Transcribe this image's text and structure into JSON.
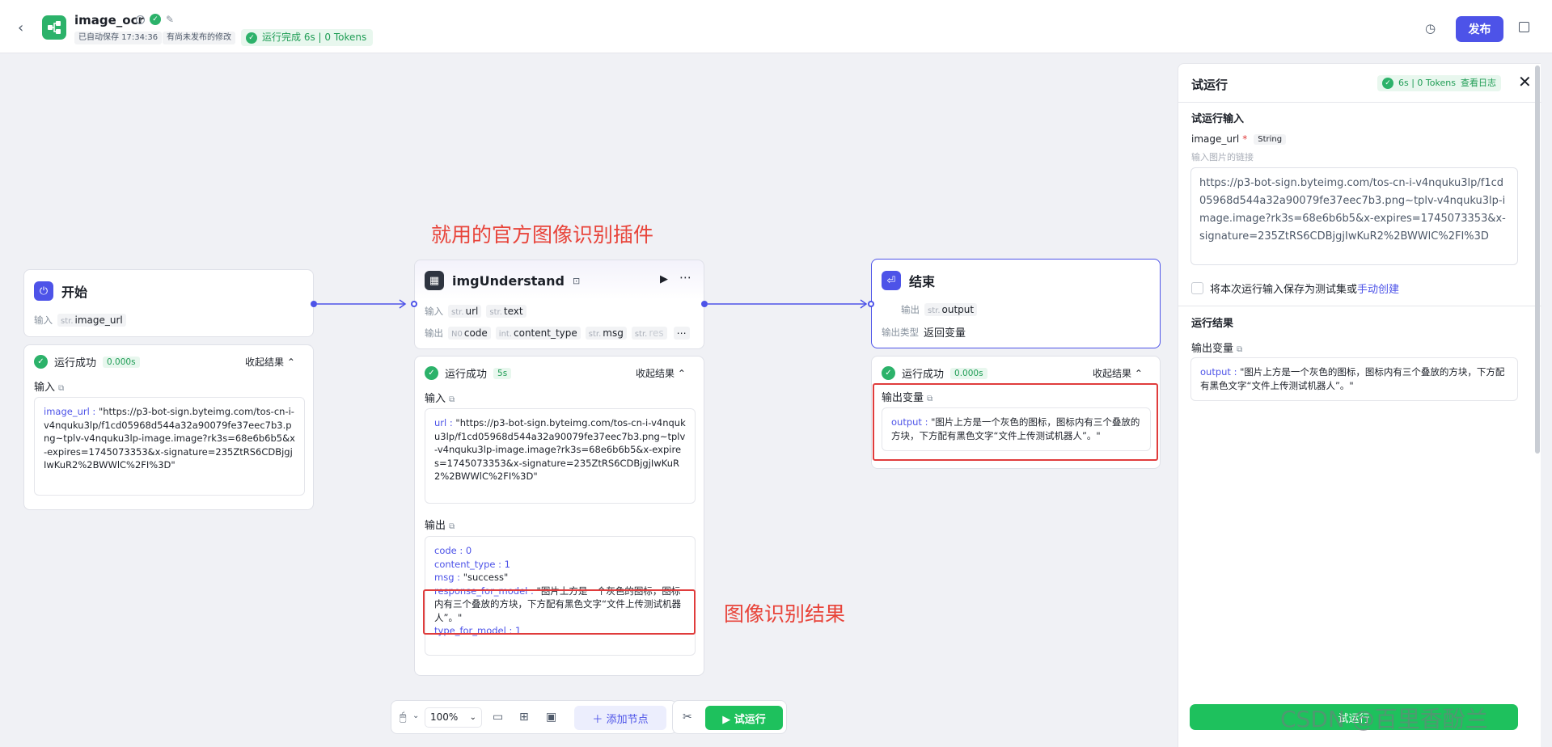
{
  "header": {
    "title": "image_ocr",
    "autosave": "已自动保存 17:34:36",
    "unpublished": "有尚未发布的修改",
    "run_status": "运行完成 6s | 0 Tokens",
    "publish_label": "发布"
  },
  "annotations": {
    "plugin_note": "就用的官方图像识别插件",
    "result_note": "图像识别结果"
  },
  "nodes": {
    "start": {
      "title": "开始",
      "input_label": "输入",
      "param_type": "str.",
      "param_name": "image_url",
      "result": {
        "status": "运行成功",
        "time": "0.000s",
        "collapse": "收起结果",
        "input_section": "输入",
        "key": "image_url",
        "value": "\"https://p3-bot-sign.byteimg.com/tos-cn-i-v4nquku3lp/f1cd05968d544a32a90079fe37eec7b3.png~tplv-v4nquku3lp-image.image?rk3s=68e6b6b5&x-expires=1745073353&x-signature=235ZtRS6CDBjgjIwKuR2%2BWWlC%2FI%3D\""
      }
    },
    "img": {
      "title": "imgUnderstand",
      "input_label": "输入",
      "output_label": "输出",
      "inputs": [
        {
          "type": "str.",
          "name": "url"
        },
        {
          "type": "str.",
          "name": "text"
        }
      ],
      "outputs": [
        {
          "type": "N0",
          "name": "code"
        },
        {
          "type": "int.",
          "name": "content_type"
        },
        {
          "type": "str.",
          "name": "msg"
        },
        {
          "type": "str.",
          "name": "res"
        }
      ],
      "result": {
        "status": "运行成功",
        "time": "5s",
        "collapse": "收起结果",
        "input_section": "输入",
        "input_key": "url",
        "input_value": "\"https://p3-bot-sign.byteimg.com/tos-cn-i-v4nquku3lp/f1cd05968d544a32a90079fe37eec7b3.png~tplv-v4nquku3lp-image.image?rk3s=68e6b6b5&x-expires=1745073353&x-signature=235ZtRS6CDBjgjIwKuR2%2BWWlC%2FI%3D\"",
        "output_section": "输出",
        "lines": [
          {
            "k": "code",
            "v": "0"
          },
          {
            "k": "content_type",
            "v": "1"
          },
          {
            "k": "msg",
            "v": "\"success\""
          },
          {
            "k": "response_for_model",
            "v": "\"图片上方是一个灰色的图标，图标内有三个叠放的方块，下方配有黑色文字“文件上传测试机器人”。\""
          },
          {
            "k": "type_for_model",
            "v": "1"
          }
        ]
      }
    },
    "end": {
      "title": "结束",
      "output_label": "输出",
      "param_type": "str.",
      "param_name": "output",
      "output_type_label": "输出类型",
      "output_type_value": "返回变量",
      "result": {
        "status": "运行成功",
        "time": "0.000s",
        "collapse": "收起结果",
        "section": "输出变量",
        "key": "output",
        "value": "\"图片上方是一个灰色的图标，图标内有三个叠放的方块，下方配有黑色文字“文件上传测试机器人”。\""
      }
    }
  },
  "panel": {
    "title": "试运行",
    "status": "6s | 0 Tokens",
    "log_link": "查看日志",
    "input_section": "试运行输入",
    "field_label": "image_url",
    "required_mark": "*",
    "field_type": "String",
    "field_hint": "输入图片的链接",
    "field_value": "https://p3-bot-sign.byteimg.com/tos-cn-i-v4nquku3lp/f1cd05968d544a32a90079fe37eec7b3.png~tplv-v4nquku3lp-image.image?rk3s=68e6b6b5&x-expires=1745073353&x-signature=235ZtRS6CDBjgjIwKuR2%2BWWlC%2FI%3D",
    "save_checkbox": "将本次运行输入保存为测试集或",
    "manual_create": "手动创建",
    "result_section": "运行结果",
    "output_var": "输出变量",
    "output_key": "output",
    "output_value": "\"图片上方是一个灰色的图标，图标内有三个叠放的方块，下方配有黑色文字“文件上传测试机器人”。\"",
    "bottom_button": "试运行"
  },
  "toolbar": {
    "zoom": "100%",
    "add_node": "添加节点",
    "test_run": "试运行"
  },
  "watermark": "CSDN @百里香酚兰"
}
